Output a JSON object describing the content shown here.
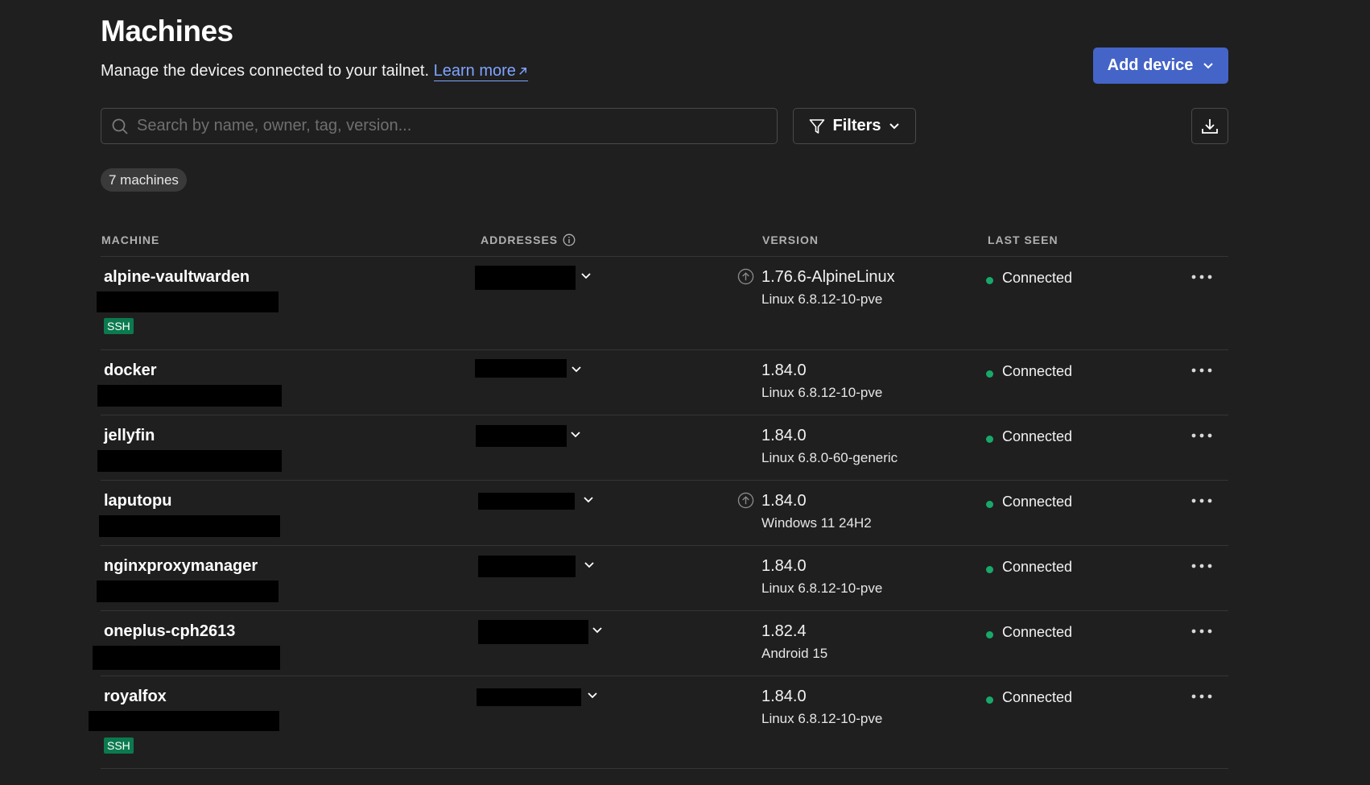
{
  "header": {
    "title": "Machines",
    "subtitle": "Manage the devices connected to your tailnet.",
    "learn_more": "Learn more",
    "add_device": "Add device"
  },
  "search": {
    "placeholder": "Search by name, owner, tag, version..."
  },
  "filters": {
    "label": "Filters"
  },
  "machines_count": "7 machines",
  "columns": {
    "machine": "MACHINE",
    "addresses": "ADDRESSES",
    "version": "VERSION",
    "last_seen": "LAST SEEN"
  },
  "icons": {
    "search": "search-icon",
    "filter": "filter-icon",
    "download": "download-icon",
    "info": "info-icon",
    "update": "update-available-icon",
    "more": "more-horizontal-icon",
    "external": "external-link-icon"
  },
  "colors": {
    "accent": "#4564c8",
    "link": "#7fa4ff",
    "connected": "#18a96a",
    "ssh_badge": "#0b7a4e",
    "background": "#1f1f1f"
  },
  "machines": [
    {
      "name": "alpine-vaultwarden",
      "ssh": "SSH",
      "version": "1.76.6-AlpineLinux",
      "os": "Linux 6.8.12-10-pve",
      "update_available": true,
      "status": "Connected"
    },
    {
      "name": "docker",
      "version": "1.84.0",
      "os": "Linux 6.8.12-10-pve",
      "update_available": false,
      "status": "Connected"
    },
    {
      "name": "jellyfin",
      "version": "1.84.0",
      "os": "Linux 6.8.0-60-generic",
      "update_available": false,
      "status": "Connected"
    },
    {
      "name": "laputopu",
      "version": "1.84.0",
      "os": "Windows 11 24H2",
      "update_available": true,
      "status": "Connected"
    },
    {
      "name": "nginxproxymanager",
      "version": "1.84.0",
      "os": "Linux 6.8.12-10-pve",
      "update_available": false,
      "status": "Connected"
    },
    {
      "name": "oneplus-cph2613",
      "version": "1.82.4",
      "os": "Android 15",
      "update_available": false,
      "status": "Connected"
    },
    {
      "name": "royalfox",
      "ssh": "SSH",
      "version": "1.84.0",
      "os": "Linux 6.8.12-10-pve",
      "update_available": false,
      "status": "Connected"
    }
  ]
}
